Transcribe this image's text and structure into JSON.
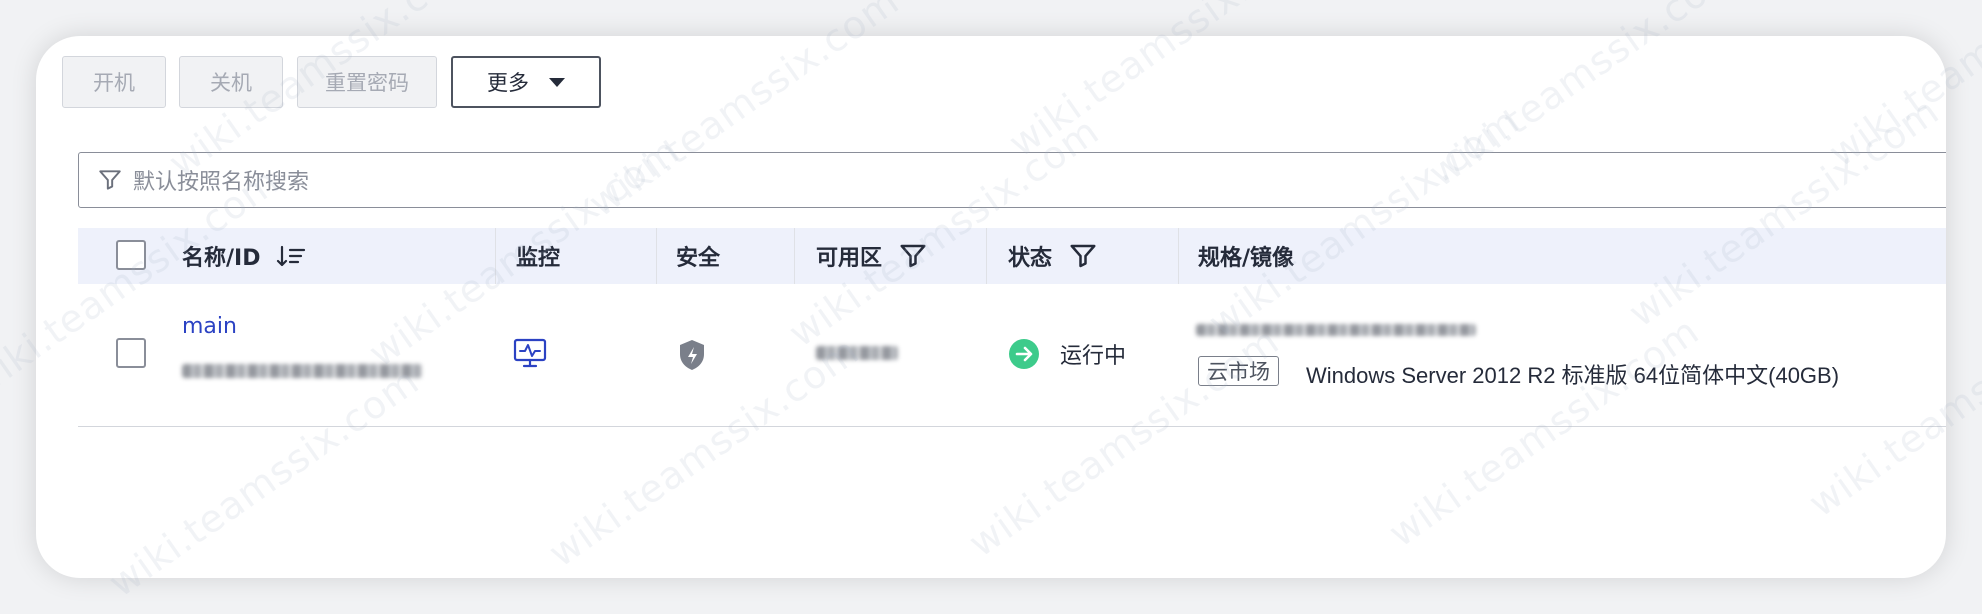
{
  "toolbar": {
    "power_on_label": "开机",
    "power_off_label": "关机",
    "reset_password_label": "重置密码",
    "more_label": "更多"
  },
  "search": {
    "placeholder": "默认按照名称搜索"
  },
  "table": {
    "columns": {
      "name": "名称/ID",
      "monitor": "监控",
      "security": "安全",
      "zone": "可用区",
      "status": "状态",
      "spec": "规格/镜像"
    },
    "rows": [
      {
        "name": "main",
        "status": "运行中",
        "image_tag": "云市场",
        "image": "Windows Server 2012 R2 标准版 64位简体中文(40GB)"
      }
    ]
  },
  "watermark_text": "wiki.teamssix.com",
  "colors": {
    "accent_link": "#2b42c3",
    "status_running": "#3dcb8b",
    "header_bg": "#eef1fb"
  },
  "icons": [
    "filter-icon",
    "sort-icon",
    "monitor-icon",
    "shield-icon",
    "running-status-icon"
  ]
}
